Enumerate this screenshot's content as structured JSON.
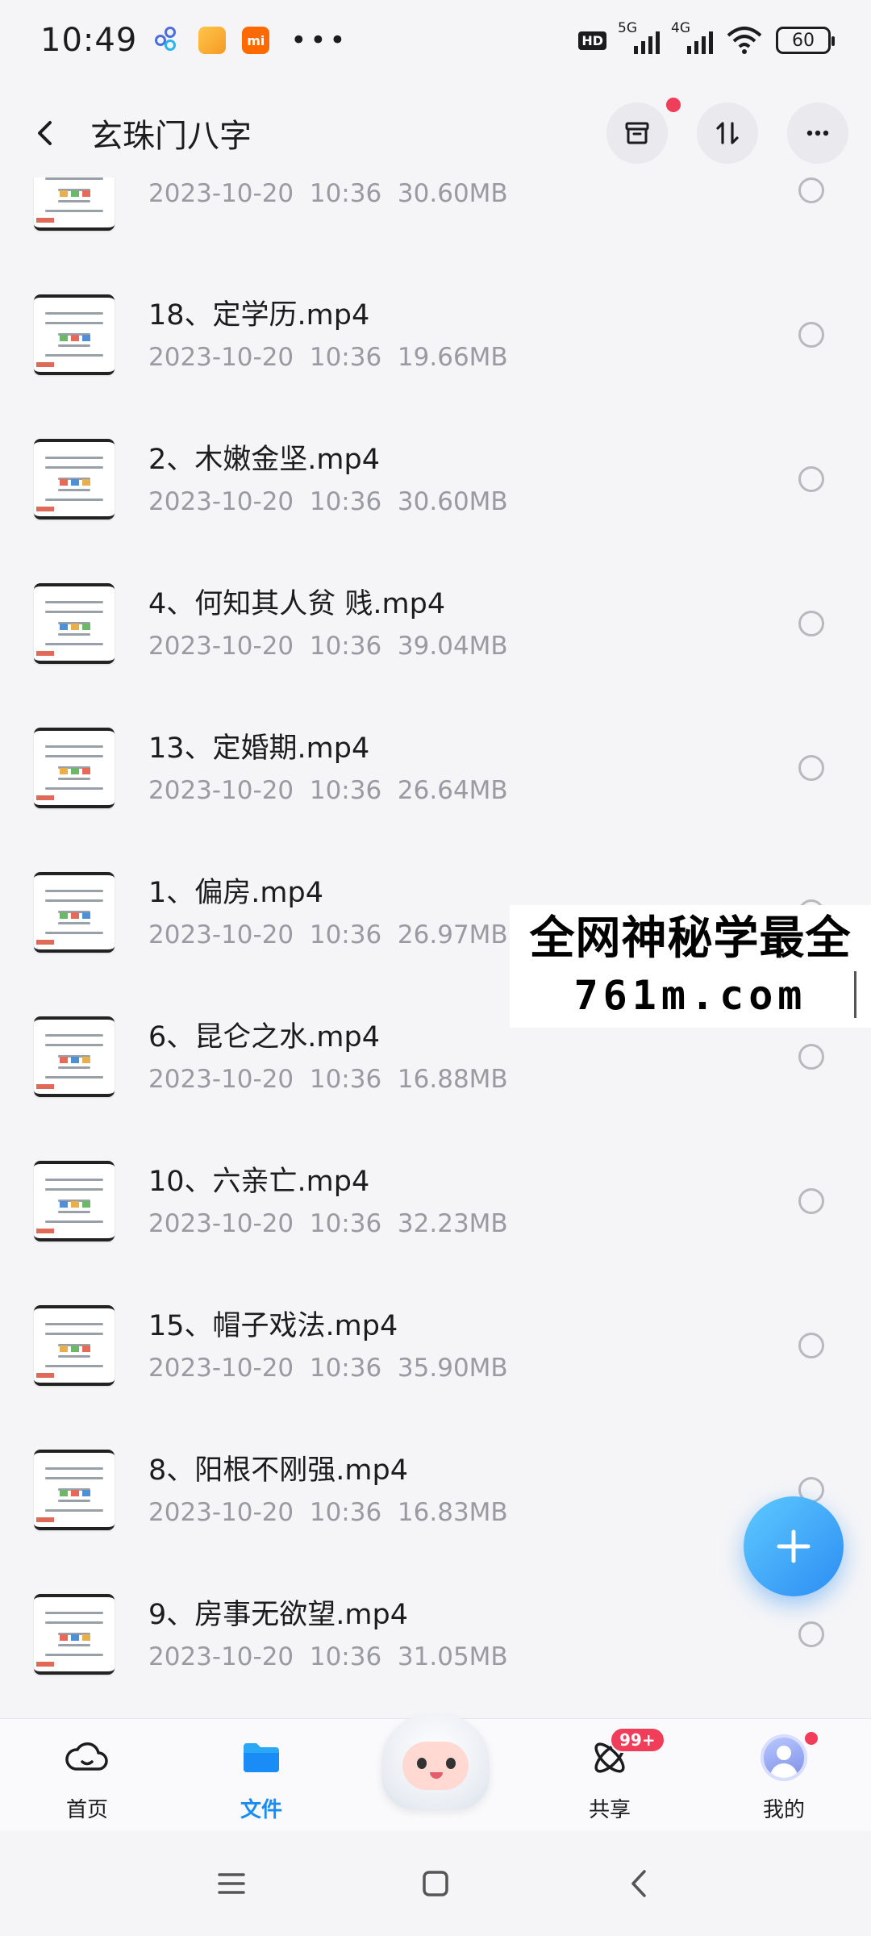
{
  "status_bar": {
    "time": "10:49",
    "app_icons": [
      "baidu-cloud-icon",
      "notes-app-icon",
      "xiaomi-app-icon"
    ],
    "more": "•••",
    "hd": "HD",
    "net1": "5G",
    "net2": "4G",
    "battery": "60"
  },
  "header": {
    "title": "玄珠门八字",
    "actions": [
      "archive-icon",
      "sort-icon",
      "more-icon"
    ]
  },
  "files": [
    {
      "name": "",
      "date": "2023-10-20  10:36",
      "size": "30.60MB"
    },
    {
      "name": "18、定学历.mp4",
      "date": "2023-10-20  10:36",
      "size": "19.66MB"
    },
    {
      "name": "2、木嫩金坚.mp4",
      "date": "2023-10-20  10:36",
      "size": "30.60MB"
    },
    {
      "name": "4、何知其人贫 贱.mp4",
      "date": "2023-10-20  10:36",
      "size": "39.04MB"
    },
    {
      "name": "13、定婚期.mp4",
      "date": "2023-10-20  10:36",
      "size": "26.64MB"
    },
    {
      "name": "1、偏房.mp4",
      "date": "2023-10-20  10:36",
      "size": "26.97MB"
    },
    {
      "name": "6、昆仑之水.mp4",
      "date": "2023-10-20  10:36",
      "size": "16.88MB"
    },
    {
      "name": "10、六亲亡.mp4",
      "date": "2023-10-20  10:36",
      "size": "32.23MB"
    },
    {
      "name": "15、帽子戏法.mp4",
      "date": "2023-10-20  10:36",
      "size": "35.90MB"
    },
    {
      "name": "8、阳根不刚强.mp4",
      "date": "2023-10-20  10:36",
      "size": "16.83MB"
    },
    {
      "name": "9、房事无欲望.mp4",
      "date": "2023-10-20  10:36",
      "size": "31.05MB"
    }
  ],
  "watermark": {
    "line1": "全网神秘学最全",
    "line2": "761m.com"
  },
  "tabs": [
    {
      "label": "首页",
      "icon": "cloud-icon"
    },
    {
      "label": "文件",
      "icon": "folder-icon"
    },
    {
      "label": "",
      "icon": "mascot-icon"
    },
    {
      "label": "共享",
      "icon": "share-atom-icon",
      "badge": "99+"
    },
    {
      "label": "我的",
      "icon": "avatar-icon"
    }
  ],
  "colors": {
    "accent": "#1a8cf5",
    "badge": "#ef3d5a",
    "background": "#f5f5f7"
  }
}
